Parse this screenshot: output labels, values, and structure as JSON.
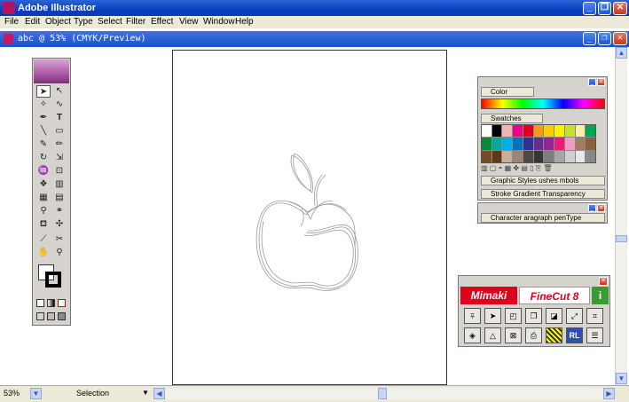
{
  "app": {
    "title": "Adobe Illustrator"
  },
  "menu": [
    "File",
    "Edit",
    "Object",
    "Type",
    "Select",
    "Filter",
    "Effect",
    "View",
    "Window",
    "Help"
  ],
  "document": {
    "title": "abc @ 53% (CMYK/Preview)"
  },
  "status": {
    "zoom": "53%",
    "tool": "Selection"
  },
  "color_panel": {
    "title": "Color"
  },
  "swatches_panel": {
    "title": "Swatches"
  },
  "styles_panel": {
    "tabs": [
      "Graphic Styles",
      "ushes",
      "mbols"
    ]
  },
  "stroke_panel": {
    "tabs": [
      "Stroke",
      "Gradient",
      "Transparency"
    ]
  },
  "character_panel": {
    "tabs": [
      "Character",
      "aragraph",
      "penType"
    ]
  },
  "mimaki": {
    "logo": "Mimaki",
    "product": "FineCut 8",
    "info": "i"
  },
  "swatch_colors": [
    "#ffffff",
    "#000000",
    "#f0b4b4",
    "#ec008c",
    "#e0001b",
    "#f39a1e",
    "#ffcc00",
    "#fff200",
    "#c8e032",
    "#f6f0a0",
    "#00a651",
    "#008c3a",
    "#00a99d",
    "#00aeef",
    "#0072bc",
    "#2e3192",
    "#662d91",
    "#92278f",
    "#ec1b7a",
    "#f49ac1",
    "#a37c5b",
    "#8c6239",
    "#754c24",
    "#603913",
    "#c7b299",
    "#998675",
    "#534741",
    "#363636",
    "#7d7d7d",
    "#a6a6a6",
    "#cfcfcf",
    "#e8e8e8"
  ]
}
